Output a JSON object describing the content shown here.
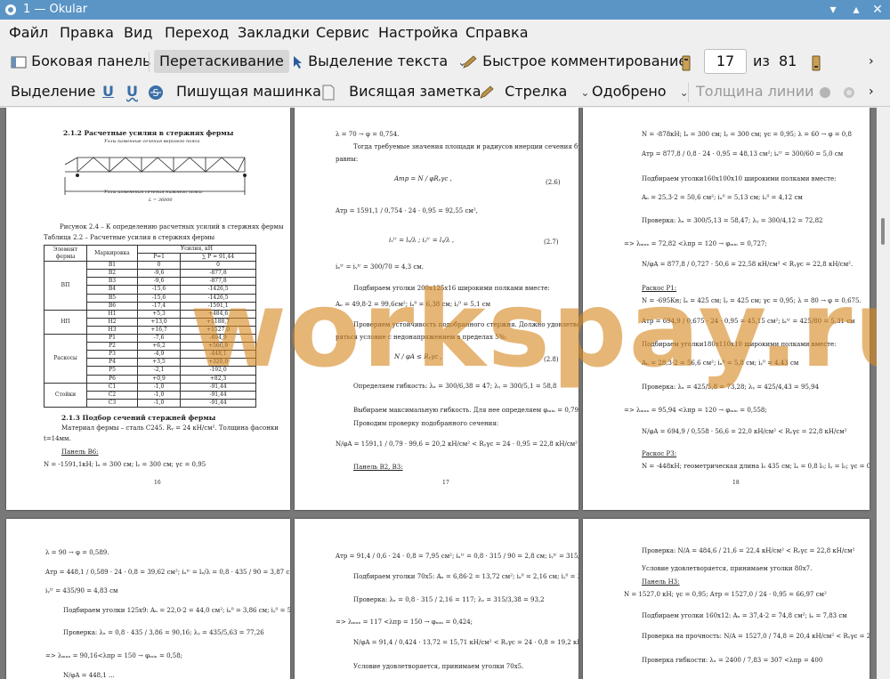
{
  "window": {
    "title": "1 — Okular"
  },
  "menu": [
    "Файл",
    "Правка",
    "Вид",
    "Переход",
    "Закладки",
    "Сервис",
    "Настройка",
    "Справка"
  ],
  "toolbar": {
    "sidebar": "Боковая панель",
    "drag": "Перетаскивание",
    "text_select": "Выделение текста",
    "quick_comment": "Быстрое комментирование",
    "current_page": "17",
    "of_label": "из",
    "total_pages": "81"
  },
  "annot_toolbar": {
    "highlight": "Выделение",
    "typewriter": "Пишущая машинка",
    "sticky_note": "Висящая заметка",
    "arrow": "Стрелка",
    "approved": "Одобрено",
    "line_width": "Толщина линии"
  },
  "watermark": "workspay.ru",
  "page16": {
    "heading": "2.1.2 Расчетные усилия в стержнях фермы",
    "upper_label": "Узлы каменные сечения верхнего пояса",
    "lower_label": "Узлы изменения сечения нижнего пояса",
    "span_label": "L = 36000",
    "fig_caption": "Рисунок 2.4 – К определению расчетных усилий в стержнях фермы",
    "table_caption": "Таблица 2.2 – Расчетные усилия в стержнях фермы",
    "th_element": "Элемент фермы",
    "th_mark": "Маркировка",
    "th_forces": "Усилия, кН",
    "th_p1": "P=1",
    "th_sum": "∑ P = 91,44",
    "groups": [
      "ВП",
      "НП",
      "Раскосы",
      "Стойки"
    ],
    "rows": [
      [
        "В1",
        "0",
        "0"
      ],
      [
        "В2",
        "-9,6",
        "-877,8"
      ],
      [
        "В3",
        "-9,6",
        "-877,8"
      ],
      [
        "В4",
        "-15,6",
        "-1426,5"
      ],
      [
        "В5",
        "-15,6",
        "-1426,5"
      ],
      [
        "В6",
        "-17,4",
        "-1591,1"
      ],
      [
        "Н1",
        "+5,3",
        "+484,6"
      ],
      [
        "Н2",
        "+13,0",
        "+1188,7"
      ],
      [
        "Н3",
        "+16,7",
        "+1527,0"
      ],
      [
        "Р1",
        "-7,6",
        "-694,9"
      ],
      [
        "Р2",
        "+6,2",
        "+566,9"
      ],
      [
        "Р3",
        "-4,9",
        "-448,1"
      ],
      [
        "Р4",
        "+3,5",
        "+320,0"
      ],
      [
        "Р5",
        "-2,1",
        "-192,0"
      ],
      [
        "Р6",
        "+0,9",
        "+82,3"
      ],
      [
        "С1",
        "-1,0",
        "-91,44"
      ],
      [
        "С2",
        "-1,0",
        "-91,44"
      ],
      [
        "С3",
        "-1,0",
        "-91,44"
      ]
    ],
    "heading2": "2.1.3 Подбор сечений стержней фермы",
    "p1": "Материал фермы – сталь С245. Rᵧ = 24 кН/см². Толщина фасонки",
    "p1b": "t=14мм.",
    "panel": "Панель В6:",
    "formula": "N = -1591,1кН; lₓ = 300 см; lᵧ = 300 см; γc = 0,95",
    "num": "16"
  },
  "page17": {
    "l1": "λ = 70 → φ = 0,754.",
    "l2": "Тогда требуемые значения площади и радиусов инерции сечения будут",
    "l3": "равны:",
    "eq1": "(2.6)",
    "l4": "Aтр = 1591,1 / 0,754 · 24 · 0,95 = 92,55 см²,",
    "eq2": "(2.7)",
    "l5": "iₓᵗʳ = iᵧᵗʳ = 300/70 = 4,3 см.",
    "l6": "Подбираем уголки 200х125х16 широкими полками вместе:",
    "l7": "Aₙ = 49,8·2 = 99,6см²; iₓ⁰ = 6,38 см; iᵧ⁰ = 5,1 см",
    "l8": "Проверяем устойчивость подобранного стержня. Должно удовлетво-",
    "l9": "ряться условие с недонапряжением в пределах 5%:",
    "eq3": "(2.8)",
    "l10": "Определяем гибкость: λₓ = 300/6,38 = 47; λᵧ = 300/5,1 = 58,8",
    "l11": "Выбираем максимальную гибкость. Для нее определяем φₘᵢₙ = 0,79.",
    "l12": "Проводим проверку подобранного сечения:",
    "l13": "N/φA = 1591,1 / 0,79 · 99,6 = 20,2 кН/см² < Rᵧγc = 24 · 0,95 = 22,8 кН/см²",
    "l14": "Панель В2, В3:",
    "num": "17"
  },
  "page18": {
    "l1": "N = -878кН; lₓ = 300 см; lᵧ = 300 см; γc = 0,95; λ = 60 → φ = 0,8",
    "l2": "Aтр = 877,8 / 0,8 · 24 · 0,95 = 48,13 см²; iₓᵗʳ = 300/60 = 5,0 см",
    "l3": "Подбираем уголки160х100х10 широкими полками вместе:",
    "l4": "Aₙ = 25,3·2 = 50,6 см²; iₓ⁰ = 5,13 см; iᵧ⁰ = 4,12 см",
    "l5": "Проверка: λₓ = 300/5,13 = 58,47; λᵧ = 300/4,12 = 72,82",
    "l6": "=> λₘₐₓ = 72,82 <λпр = 120 → φₘᵢₙ = 0,727;",
    "l7": "N/φA = 877,8 / 0,727 · 50,6 = 22,58 кН/см² < Rᵧγc = 22,8 кН/см².",
    "l8": "Раскос Р1:",
    "l9": "N = -695Кн; lₓ = 425 см; lᵧ = 425 см; γc = 0,95; λ = 80 → φ = 0,675.",
    "l10": "Aтр = 694,9 / 0,675 · 24 · 0,95 = 45,15 см²; iₓᵗʳ = 425/80 = 5,31 см",
    "l11": "Подбираем уголки180х110х10 широкими полками вместе:",
    "l12": "Aₙ = 28,3·2 = 56,6 см²; iₓ⁰ = 5,8 см; iᵧ⁰ = 4,43 см",
    "l13": "Проверка: λₓ = 425/5,8 = 73,28; λᵧ = 425/4,43 = 95,94",
    "l14": "=> λₘₐₓ = 95,94 <λпр = 120 → φₘᵢₙ = 0,558;",
    "l15": "N/φA = 694,9 / 0,558 · 56,6 = 22,0 кН/см² < Rᵧγc = 22,8 кН/см²",
    "l16": "Раскос Р3:",
    "l17": "N = -448кН; геометрическая длина l₀ 435 см; lₓ = 0,8 l₀; lᵧ = l₀; γc = 0,8",
    "num": "18"
  },
  "page19": {
    "l1": "λ = 90 → φ = 0,589.",
    "l2": "Aтр = 448,1 / 0,589 · 24 · 0,8 = 39,62 см²; iₓᵗʳ = lₓ/λ = 0,8 · 435 / 90 = 3,87 см;",
    "l3": "iᵧᵗʳ = 435/90 = 4,83 см",
    "l4": "Подбираем уголки 125х9: Aₙ = 22,0·2 = 44,0 см²; iₓ⁰ = 3,86 см; iᵧ⁰ = 5,63 см",
    "l5": "Проверка: λₓ = 0,8 · 435 / 3,86 = 90,16; λᵧ = 435/5,63 = 77,26",
    "l6": "=> λₘₐₓ = 90,16<λпр = 150 → φₘᵢₙ = 0,58;",
    "l7": "N/φA = 448,1 ..."
  },
  "page20": {
    "l1": "Aтр = 91,4 / 0,6 · 24 · 0,8 = 7,95 см²; iₓᵗʳ = 0,8 · 315 / 90 = 2,8 см; iᵧᵗʳ = 315/90 = 3,5 см",
    "l2": "Подбираем уголки 70х5: Aₙ = 6,86·2 = 13,72 см²; iₓ⁰ = 2,16 см; iᵧ⁰ = 3,38 см",
    "l3": "Проверка: λₓ = 0,8 · 315 / 2,16 = 117; λᵧ = 315/3,38 = 93,2",
    "l4": "=> λₘₐₓ = 117 <λпр = 150 → φₘᵢₙ = 0,424;",
    "l5": "N/φA = 91,4 / 0,424 · 13,72 = 15,71 кН/см² < Rᵧγc = 24 · 0,8 = 19,2 кН/см²",
    "l6": "Условие удовлетворяется, принимаем уголки 70х5."
  },
  "page21": {
    "l1": "Проверка: N/A = 484,6 / 21,6 = 22,4 кН/см² < Rᵧγc = 22,8 кН/см²",
    "l2": "Условие удовлетворяется, принимаем уголки 80х7.",
    "l3": "Панель Н3:",
    "l4": "N = 1527,0 кН; γc = 0,95; Aтр = 1527,0 / 24 · 0,95 = 66,97 см²",
    "l5": "Подбираем уголки 160х12: Aₙ = 37,4·2 = 74,8 см²; iₓ = 7,83 см",
    "l6": "Проверка на прочность: N/A = 1527,0 / 74,8 = 20,4 кН/см² < Rᵧγc = 22,8 кН/см²",
    "l7": "Проверка гибкости: λₓ = 2400 / 7,83 = 307 <λпр = 400"
  }
}
